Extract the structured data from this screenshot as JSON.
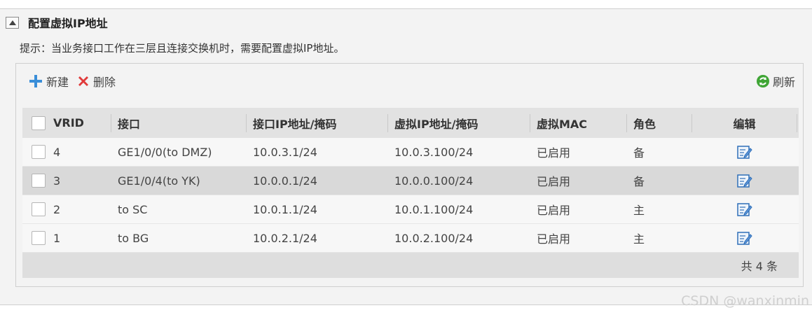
{
  "panel": {
    "title": "配置虚拟IP地址",
    "hint": "提示：当业务接口工作在三层且连接交换机时，需要配置虚拟IP地址。"
  },
  "toolbar": {
    "new_label": "新建",
    "delete_label": "删除",
    "refresh_label": "刷新"
  },
  "table": {
    "headers": [
      "VRID",
      "接口",
      "接口IP地址/掩码",
      "虚拟IP地址/掩码",
      "虚拟MAC",
      "角色",
      "编辑"
    ],
    "rows": [
      {
        "vrid": "4",
        "interface": "GE1/0/0(to DMZ)",
        "if_ip": "10.0.3.1/24",
        "vip": "10.0.3.100/24",
        "mac": "已启用",
        "role": "备"
      },
      {
        "vrid": "3",
        "interface": "GE1/0/4(to YK)",
        "if_ip": "10.0.0.1/24",
        "vip": "10.0.0.100/24",
        "mac": "已启用",
        "role": "备"
      },
      {
        "vrid": "2",
        "interface": "to SC",
        "if_ip": "10.0.1.1/24",
        "vip": "10.0.1.100/24",
        "mac": "已启用",
        "role": "主"
      },
      {
        "vrid": "1",
        "interface": "to BG",
        "if_ip": "10.0.2.1/24",
        "vip": "10.0.2.100/24",
        "mac": "已启用",
        "role": "主"
      }
    ],
    "total": "共 4 条"
  },
  "watermark": "CSDN @wanxinmin",
  "colors": {
    "add_icon": "#3a8ed8",
    "delete_icon": "#e03a3a",
    "refresh_icon": "#3fa535",
    "edit_icon": "#2f6fb8"
  }
}
